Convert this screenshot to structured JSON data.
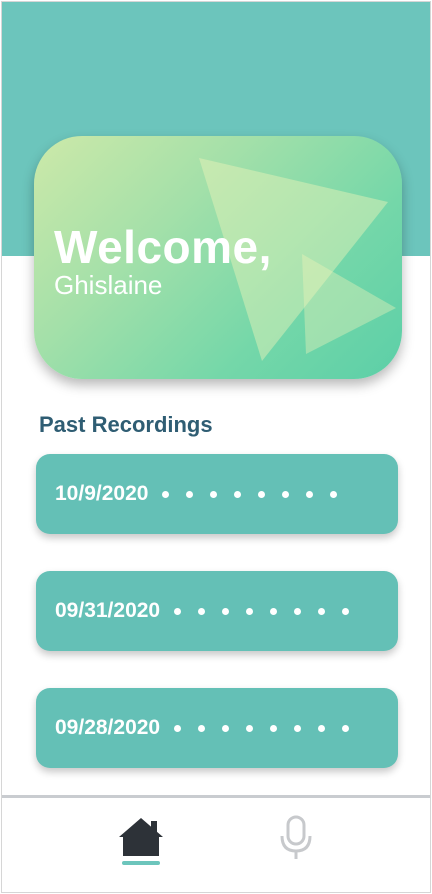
{
  "welcome": {
    "title": "Welcome,",
    "name": "Ghislaine"
  },
  "recordings": {
    "section_title": "Past Recordings",
    "items": [
      {
        "date": "10/9/2020"
      },
      {
        "date": "09/31/2020"
      },
      {
        "date": "09/28/2020"
      }
    ]
  },
  "nav": {
    "items": [
      {
        "icon": "home-icon",
        "active": true
      },
      {
        "icon": "microphone-icon",
        "active": false
      }
    ]
  },
  "colors": {
    "accent": "#6cc5bc",
    "card_item": "#64c0b6",
    "heading": "#2f5d73",
    "inactive_icon": "#c7c9cc"
  }
}
